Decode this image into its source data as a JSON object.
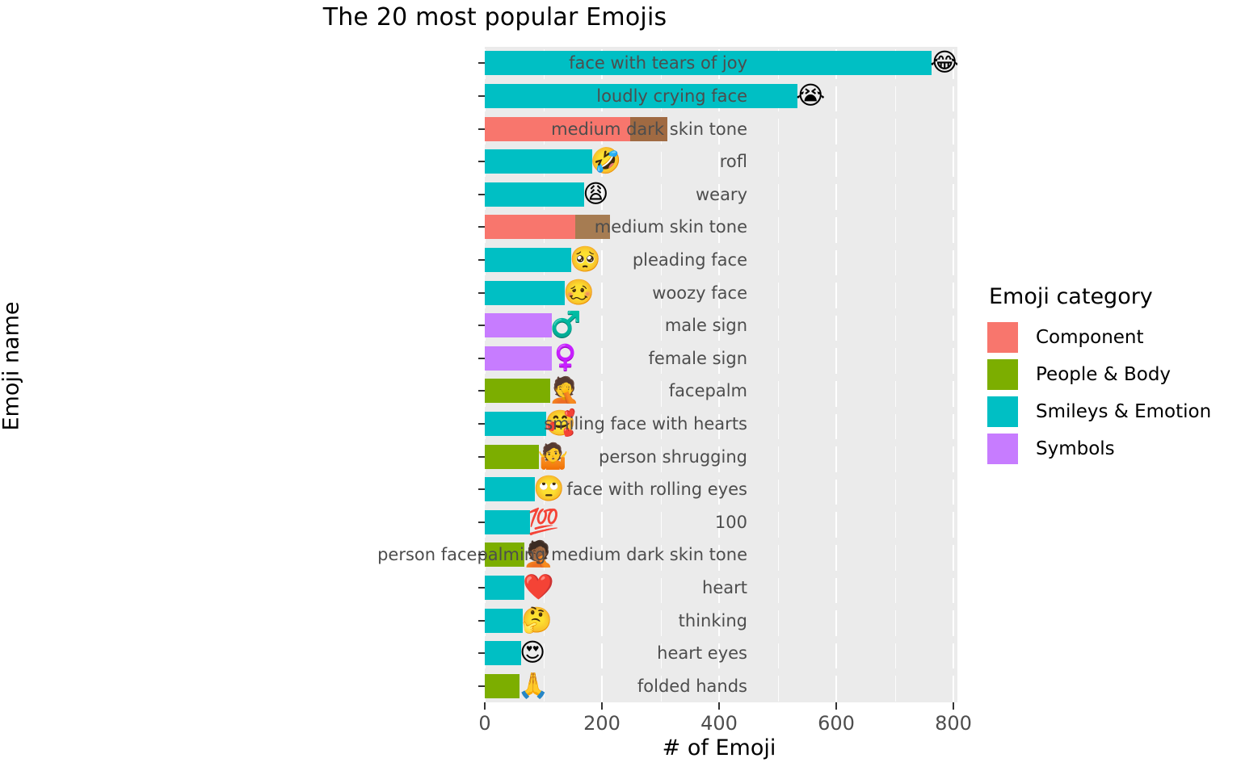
{
  "chart_data": {
    "type": "bar",
    "orientation": "horizontal",
    "stacked": true,
    "title": "The 20 most popular Emojis",
    "xlabel": "# of Emoji",
    "ylabel": "Emoji name",
    "xlim": [
      0,
      820
    ],
    "xticks": [
      0,
      200,
      400,
      600,
      800
    ],
    "xtick_labels": [
      "0",
      "200",
      "400",
      "600",
      "800"
    ],
    "grid": "major-and-minor-vertical, major-horizontal",
    "legend": {
      "title": "Emoji category",
      "position": "right",
      "entries": [
        {
          "label": "Component",
          "color": "#F8766D"
        },
        {
          "label": "People & Body",
          "color": "#7CAE00"
        },
        {
          "label": "Smileys & Emotion",
          "color": "#00BFC4"
        },
        {
          "label": "Symbols",
          "color": "#C77CFF"
        }
      ]
    },
    "extra_colors": {
      "skin_tone_swatch": "#A06A42"
    },
    "categories": [
      "face with tears of joy",
      "loudly crying face",
      "medium dark skin tone",
      "rofl",
      "weary",
      "medium skin tone",
      "pleading face",
      "woozy face",
      "male sign",
      "female sign",
      "facepalm",
      "smiling face with hearts",
      "person shrugging",
      "face with rolling eyes",
      "100",
      "person facepalming medium dark skin tone",
      "heart",
      "thinking",
      "heart eyes",
      "folded hands"
    ],
    "bars": [
      {
        "name": "face with tears of joy",
        "value": 763,
        "category": "Smileys & Emotion",
        "color": "#00BFC4",
        "glyph": "😂",
        "swatch": null
      },
      {
        "name": "loudly crying face",
        "value": 534,
        "category": "Smileys & Emotion",
        "color": "#00BFC4",
        "glyph": "😭",
        "swatch": null
      },
      {
        "name": "medium dark skin tone",
        "value": 248,
        "category": "Component",
        "color": "#F8766D",
        "glyph": "",
        "swatch": {
          "color": "#A06A42",
          "width": 46
        }
      },
      {
        "name": "rofl",
        "value": 183,
        "category": "Smileys & Emotion",
        "color": "#00BFC4",
        "glyph": "🤣",
        "swatch": null
      },
      {
        "name": "weary",
        "value": 170,
        "category": "Smileys & Emotion",
        "color": "#00BFC4",
        "glyph": "😩",
        "swatch": null
      },
      {
        "name": "medium skin tone",
        "value": 154,
        "category": "Component",
        "color": "#F8766D",
        "glyph": "",
        "swatch": {
          "color": "#A67C52",
          "width": 43
        }
      },
      {
        "name": "pleading face",
        "value": 148,
        "category": "Smileys & Emotion",
        "color": "#00BFC4",
        "glyph": "🥺",
        "swatch": null
      },
      {
        "name": "woozy face",
        "value": 137,
        "category": "Smileys & Emotion",
        "color": "#00BFC4",
        "glyph": "🥴",
        "swatch": null
      },
      {
        "name": "male sign",
        "value": 115,
        "category": "Symbols",
        "color": "#C77CFF",
        "glyph": "♂️",
        "swatch": null
      },
      {
        "name": "female sign",
        "value": 114,
        "category": "Symbols",
        "color": "#C77CFF",
        "glyph": "♀️",
        "swatch": null
      },
      {
        "name": "facepalm",
        "value": 112,
        "category": "People & Body",
        "color": "#7CAE00",
        "glyph": "🤦",
        "swatch": null
      },
      {
        "name": "smiling face with hearts",
        "value": 105,
        "category": "Smileys & Emotion",
        "color": "#00BFC4",
        "glyph": "🥰",
        "swatch": null
      },
      {
        "name": "person shrugging",
        "value": 93,
        "category": "People & Body",
        "color": "#7CAE00",
        "glyph": "🤷",
        "swatch": null
      },
      {
        "name": "face with rolling eyes",
        "value": 86,
        "category": "Smileys & Emotion",
        "color": "#00BFC4",
        "glyph": "🙄",
        "swatch": null
      },
      {
        "name": "100",
        "value": 77,
        "category": "Smileys & Emotion",
        "color": "#00BFC4",
        "glyph": "💯",
        "swatch": null
      },
      {
        "name": "person facepalming medium dark skin tone",
        "value": 68,
        "category": "People & Body",
        "color": "#7CAE00",
        "glyph": "🤦🏾",
        "swatch": null
      },
      {
        "name": "heart",
        "value": 68,
        "category": "Smileys & Emotion",
        "color": "#00BFC4",
        "glyph": "❤️",
        "swatch": null
      },
      {
        "name": "thinking",
        "value": 65,
        "category": "Smileys & Emotion",
        "color": "#00BFC4",
        "glyph": "🤔",
        "swatch": null
      },
      {
        "name": "heart eyes",
        "value": 62,
        "category": "Smileys & Emotion",
        "color": "#00BFC4",
        "glyph": "😍",
        "swatch": null
      },
      {
        "name": "folded hands",
        "value": 59,
        "category": "People & Body",
        "color": "#7CAE00",
        "glyph": "🙏",
        "swatch": null
      }
    ]
  }
}
